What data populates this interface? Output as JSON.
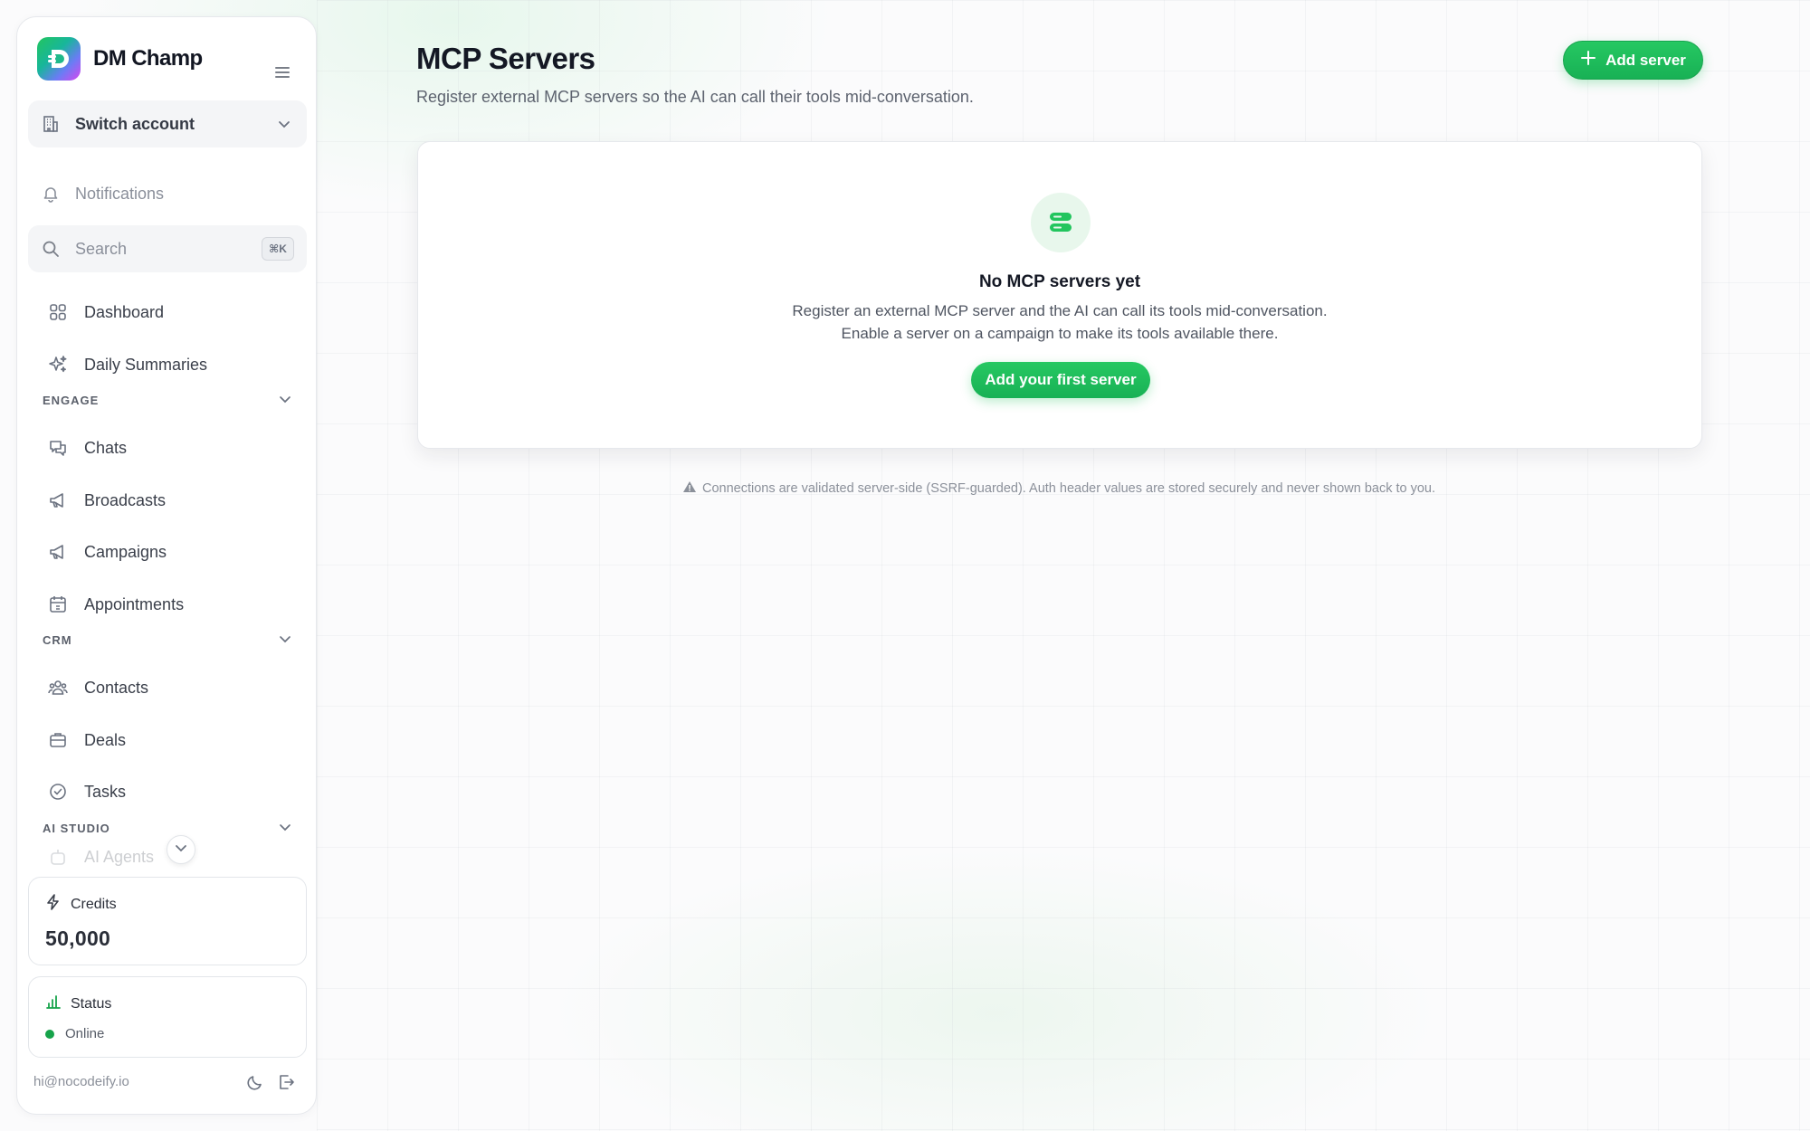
{
  "brand": {
    "name": "DM Champ"
  },
  "sidebar": {
    "switch_account": "Switch account",
    "notifications": "Notifications",
    "search": {
      "label": "Search",
      "shortcut": "⌘K"
    },
    "items_top": [
      {
        "label": "Dashboard",
        "icon": "grid-icon"
      },
      {
        "label": "Daily Summaries",
        "icon": "sparkles-icon"
      }
    ],
    "engage": {
      "title": "ENGAGE",
      "items": [
        {
          "label": "Chats",
          "icon": "chat-icon"
        },
        {
          "label": "Broadcasts",
          "icon": "megaphone-icon"
        },
        {
          "label": "Campaigns",
          "icon": "megaphone-icon"
        },
        {
          "label": "Appointments",
          "icon": "calendar-icon"
        }
      ]
    },
    "crm": {
      "title": "CRM",
      "items": [
        {
          "label": "Contacts",
          "icon": "users-icon"
        },
        {
          "label": "Deals",
          "icon": "briefcase-icon"
        },
        {
          "label": "Tasks",
          "icon": "check-circle-icon"
        }
      ]
    },
    "ai_studio": {
      "title": "AI STUDIO",
      "items": [
        {
          "label": "AI Agents",
          "icon": "bot-icon"
        }
      ]
    },
    "credits": {
      "title": "Credits",
      "value": "50,000"
    },
    "status": {
      "title": "Status",
      "value": "Online"
    },
    "email": "hi@nocodeify.io"
  },
  "main": {
    "title": "MCP Servers",
    "subtitle": "Register external MCP servers so the AI can call their tools mid-conversation.",
    "add_button": "Add server",
    "empty": {
      "title": "No MCP servers yet",
      "line1": "Register an external MCP server and the AI can call its tools mid-conversation.",
      "line2": "Enable a server on a campaign to make its tools available there.",
      "button": "Add your first server"
    },
    "note": "Connections are validated server-side (SSRF-guarded). Auth header values are stored securely and never shown back to you."
  },
  "colors": {
    "accent": "#22c55e",
    "status_online": "#16a34a"
  }
}
